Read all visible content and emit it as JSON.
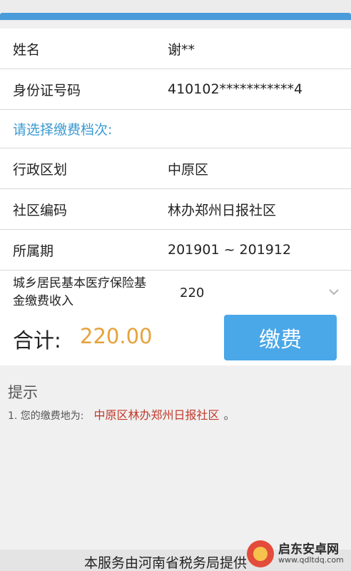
{
  "form": {
    "name_label": "姓名",
    "name_value": "谢**",
    "id_label": "身份证号码",
    "id_value": "410102***********4",
    "section_title": "请选择缴费档次:",
    "district_label": "行政区划",
    "district_value": "中原区",
    "community_label": "社区编码",
    "community_value": "林办郑州日报社区",
    "period_label": "所属期",
    "period_value": "201901 ~ 201912",
    "insurance_label": "城乡居民基本医疗保险基金缴费收入",
    "insurance_value": "220"
  },
  "total": {
    "label": "合计:",
    "amount": "220.00",
    "pay_button": "缴费"
  },
  "tips": {
    "title": "提示",
    "line_prefix": "1. 您的缴费地为:",
    "line_location": "中原区林办郑州日报社区",
    "line_end": "。"
  },
  "footer": {
    "text": "本服务由河南省税务局提供"
  },
  "watermark": {
    "name": "启东安卓网",
    "url": "www.qdltdq.com"
  },
  "colors": {
    "accent": "#4a9bd9",
    "section_title": "#3a9ad3",
    "amount": "#e6a23c",
    "pay_button": "#4aa7e8",
    "highlight": "#c0392b"
  }
}
